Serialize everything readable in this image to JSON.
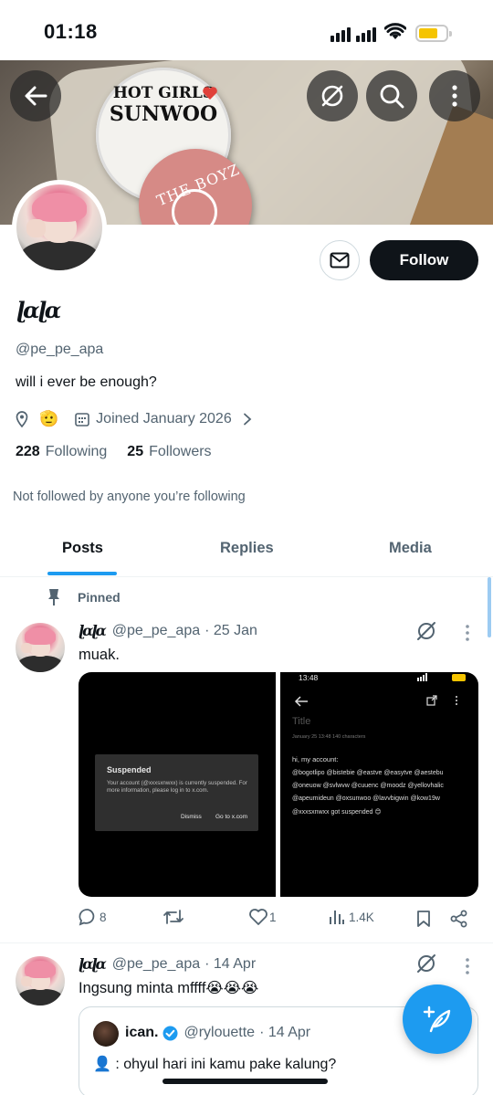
{
  "status_bar": {
    "time": "01:18",
    "battery_color": "#f5c400"
  },
  "banner": {
    "pin1_line1": "HOT GIRLS",
    "pin1_line2": "SUNWOO",
    "pin2_text": "THE BOYZ",
    "icons": [
      "back-arrow-icon",
      "grok-icon",
      "search-icon",
      "more-vertical-icon"
    ]
  },
  "profile": {
    "display_name": "ɭɑɭɑ",
    "handle": "@pe_pe_apa",
    "bio": "will i ever be enough?",
    "location_emoji": "🫡",
    "joined": "Joined January 2026",
    "following_count": "228",
    "following_label": "Following",
    "followers_count": "25",
    "followers_label": "Followers",
    "not_followed": "Not followed by anyone you’re following",
    "follow_label": "Follow"
  },
  "tabs": [
    {
      "label": "Posts",
      "active": true
    },
    {
      "label": "Replies",
      "active": false
    },
    {
      "label": "Media",
      "active": false
    }
  ],
  "posts": [
    {
      "pinned_label": "Pinned",
      "name": "ɭɑɭɑ",
      "handle": "@pe_pe_apa",
      "date": "· 25 Jan",
      "text": "muak.",
      "media": {
        "left": {
          "title": "Suspended",
          "body": "Your account (@xxxsxnwxx) is currently suspended. For more information, please log in to x.com.",
          "dismiss": "Dismiss",
          "goto": "Go to x.com"
        },
        "right": {
          "time": "13:48",
          "title": "Title",
          "meta": "January 25  13:48     140 characters",
          "lines": [
            "hi, my account:",
            "@bogotlipo @bistebie @eastve @easytve @aestebu",
            "@oneuow @svlwvw @cuuenc @moodz @yellovhalic",
            "@apeumideun @oxsunwoo @lavvbigwin @kow19w",
            "@xxxsxnwxx got suspended 😊"
          ]
        }
      },
      "replies": "8",
      "retweets": "",
      "likes": "1",
      "views": "1.4K"
    },
    {
      "name": "ɭɑɭɑ",
      "handle": "@pe_pe_apa",
      "date": "· 14 Apr",
      "text": "Ingsung minta mffff😭😭😭",
      "quote": {
        "name": "ican.",
        "handle": "@rylouette",
        "date": "· 14 Apr",
        "text": "👤 : ohyul hari ini kamu pake kalung?"
      }
    }
  ],
  "colors": {
    "accent": "#1d9bf0",
    "text": "#0f1419",
    "muted": "#536471",
    "border": "#cfd9de"
  }
}
